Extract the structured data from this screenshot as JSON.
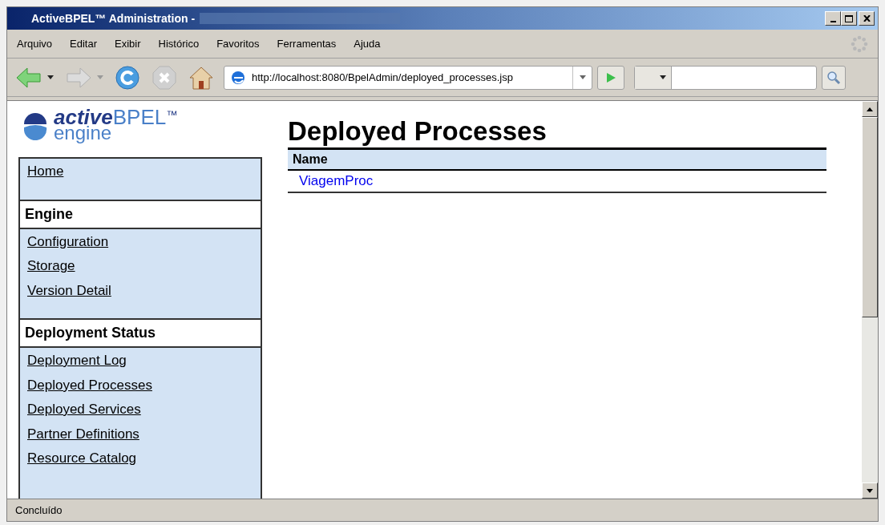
{
  "window": {
    "title": "ActiveBPEL™ Administration -"
  },
  "menu": [
    "Arquivo",
    "Editar",
    "Exibir",
    "Histórico",
    "Favoritos",
    "Ferramentas",
    "Ajuda"
  ],
  "toolbar": {
    "address": "http://localhost:8080/BpelAdmin/deployed_processes.jsp"
  },
  "logo": {
    "brand_a": "active",
    "brand_b": "BPEL",
    "tm": "™",
    "sub": "engine"
  },
  "sidebar": {
    "sections": [
      {
        "links": [
          "Home"
        ]
      },
      {
        "heading": "Engine",
        "links": [
          "Configuration",
          "Storage",
          "Version Detail"
        ]
      },
      {
        "heading": "Deployment Status",
        "links": [
          "Deployment Log",
          "Deployed Processes",
          "Deployed Services",
          "Partner Definitions",
          "Resource Catalog"
        ]
      }
    ]
  },
  "page": {
    "title": "Deployed Processes",
    "table": {
      "columns": [
        "Name"
      ],
      "rows": [
        [
          "ViagemProc"
        ]
      ]
    }
  },
  "status_bar": "Concluído"
}
